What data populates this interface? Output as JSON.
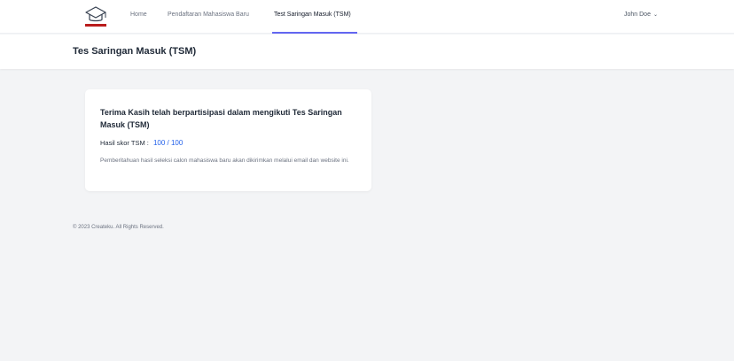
{
  "nav": {
    "home": "Home",
    "registration": "Pendaftaran Mahasiswa Baru",
    "tsm": "Test Saringan Masuk (TSM)",
    "user_name": "John Doe"
  },
  "header": {
    "title": "Tes Saringan Masuk (TSM)"
  },
  "card": {
    "title": "Terima Kasih telah berpartisipasi dalam mengikuti Tes Saringan Masuk (TSM)",
    "score_label": "Hasil skor TSM :",
    "score_value": "100 / 100",
    "note": "Pemberitahuan hasil seleksi calon mahasiswa baru akan dikirimkan melalui email dan website ini."
  },
  "footer": {
    "copyright": "© 2023 Createku. All Rights Reserved."
  },
  "colors": {
    "accent": "#6366f1",
    "score": "#2563eb",
    "logo": "#b91c1c"
  }
}
